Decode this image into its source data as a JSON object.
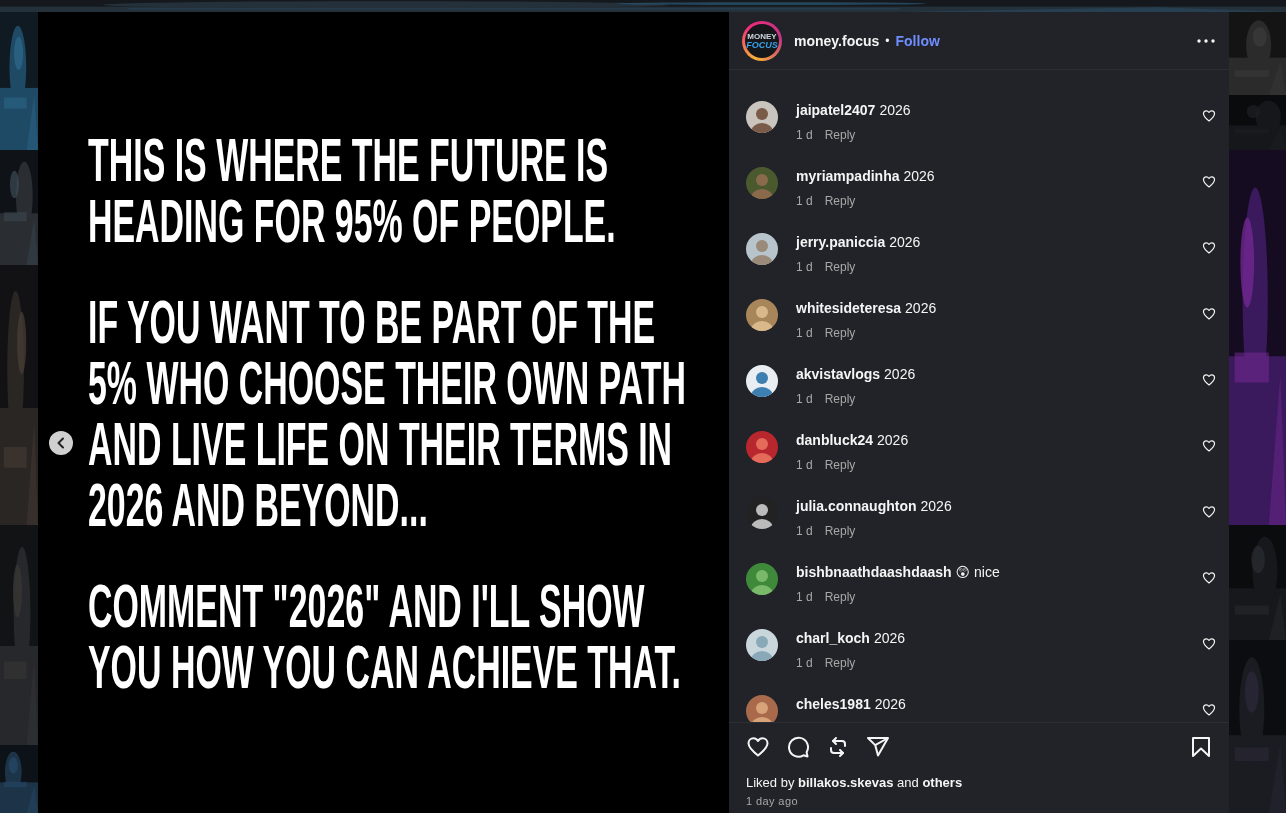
{
  "post": {
    "paragraphs": [
      "THIS IS WHERE THE FUTURE IS HEADING FOR 95% OF PEOPLE.",
      "IF YOU WANT TO BE PART OF THE 5% WHO CHOOSE THEIR OWN PATH AND LIVE LIFE ON THEIR TERMS IN 2026 AND BEYOND...",
      "COMMENT \"2026\" AND I'LL SHOW YOU HOW YOU CAN ACHIEVE THAT."
    ]
  },
  "header": {
    "logo_top": "MONEY",
    "logo_bottom": "FOCUS",
    "username": "money.focus",
    "separator": "•",
    "follow": "Follow"
  },
  "comments": [
    {
      "user": "jaipatel2407",
      "text": "2026",
      "time": "1 d",
      "reply": "Reply",
      "liked": false
    },
    {
      "user": "myriampadinha",
      "text": "2026",
      "time": "1 d",
      "reply": "Reply",
      "liked": false
    },
    {
      "user": "jerry.paniccia",
      "text": "2026",
      "time": "1 d",
      "reply": "Reply",
      "liked": false
    },
    {
      "user": "whitesideteresa",
      "text": "2026",
      "time": "1 d",
      "reply": "Reply",
      "liked": false
    },
    {
      "user": "akvistavlogs",
      "text": "2026",
      "time": "1 d",
      "reply": "Reply",
      "liked": false
    },
    {
      "user": "danbluck24",
      "text": "2026",
      "time": "1 d",
      "reply": "Reply",
      "liked": false
    },
    {
      "user": "julia.connaughton",
      "text": "2026",
      "time": "1 d",
      "reply": "Reply",
      "liked": false
    },
    {
      "user": "bishbnaathdaashdaash",
      "text": "😲 nice",
      "time": "1 d",
      "reply": "Reply",
      "liked": false
    },
    {
      "user": "charl_koch",
      "text": "2026",
      "time": "1 d",
      "reply": "Reply",
      "liked": false
    },
    {
      "user": "cheles1981",
      "text": "2026",
      "liked": false
    }
  ],
  "actions": {
    "liked": false,
    "saved": false
  },
  "likes": {
    "prefix": "Liked by",
    "user": "billakos.skevas",
    "joiner": "and",
    "others": "others"
  },
  "posted": "1 day ago"
}
